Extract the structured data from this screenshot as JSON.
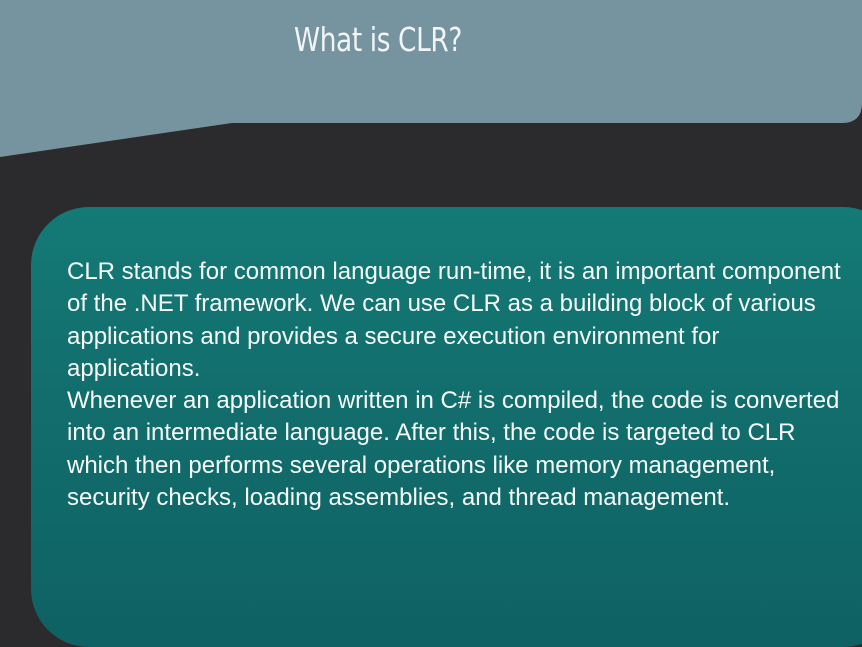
{
  "slide": {
    "title": "What is CLR?",
    "paragraphs": [
      "CLR stands for common language run-time, it is an important component of the .NET framework. We can use CLR as a building block of various applications and provides a secure execution environment for applications.",
      "Whenever an application written in C# is compiled, the code is converted into an intermediate language. After this, the code is targeted to CLR which then performs several operations like memory management, security checks, loading assemblies, and thread management."
    ]
  },
  "colors": {
    "background": "#2b2a2c",
    "header": "#75949f",
    "panel": "#147a76",
    "text": "#f7fbfb"
  }
}
